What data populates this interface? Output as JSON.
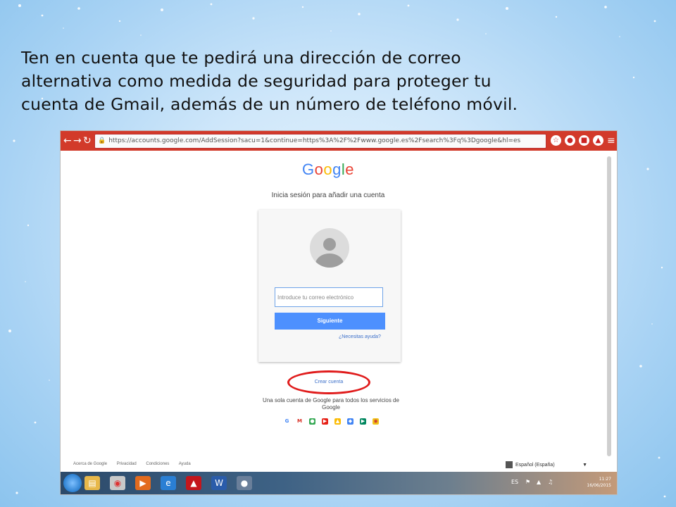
{
  "caption": {
    "line1": "Ten en cuenta que te pedirá una dirección de correo",
    "line2": "alternativa como medida de seguridad para proteger tu",
    "line3": "cuenta de Gmail, además de un número de teléfono móvil."
  },
  "browser": {
    "url": "https://accounts.google.com/AddSession?sacu=1&continue=https%3A%2F%2Fwww.google.es%2Fsearch%3Fq%3Dgoogle&hl=es",
    "accent_color": "#d23a2a"
  },
  "google": {
    "logo": "Google",
    "subtitle": "Inicia sesión para añadir una cuenta",
    "email_placeholder": "Introduce tu correo electrónico",
    "next_label": "Siguiente",
    "help_link": "¿Necesitas ayuda?",
    "create_account": "Crear cuenta",
    "tagline": "Una sola cuenta de Google para todos los servicios de Google",
    "apps": [
      "google-icon",
      "gmail-icon",
      "drive-icon",
      "youtube-icon",
      "maps-icon",
      "play-icon",
      "chrome-icon"
    ]
  },
  "footer": {
    "links": [
      "Acerca de Google",
      "Privacidad",
      "Condiciones",
      "Ayuda"
    ],
    "language": "Español (España)"
  },
  "taskbar": {
    "time": "11:27",
    "date": "16/06/2015",
    "tray_lang": "ES"
  }
}
